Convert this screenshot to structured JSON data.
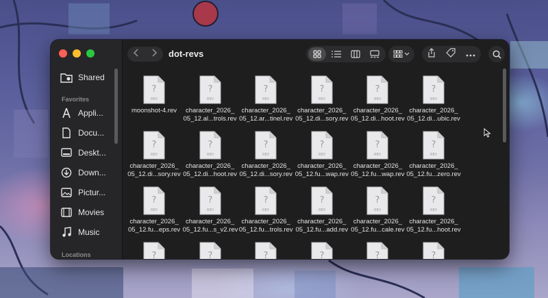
{
  "window": {
    "title": "dot-revs"
  },
  "sidebar": {
    "top_item": {
      "label": "Shared",
      "icon": "shared-folder-icon"
    },
    "section_favorites": "Favorites",
    "items": [
      {
        "label": "Appli...",
        "icon": "applications-icon"
      },
      {
        "label": "Docu...",
        "icon": "document-icon"
      },
      {
        "label": "Deskt...",
        "icon": "desktop-icon"
      },
      {
        "label": "Down...",
        "icon": "download-icon"
      },
      {
        "label": "Pictur...",
        "icon": "pictures-icon"
      },
      {
        "label": "Movies",
        "icon": "movies-icon"
      },
      {
        "label": "Music",
        "icon": "music-icon"
      }
    ],
    "section_locations": "Locations"
  },
  "file_icon_text": {
    "mark": "?",
    "ext": "REV"
  },
  "files": [
    {
      "line1": "moonshot-4.rev",
      "line2": ""
    },
    {
      "line1": "character_2026_",
      "line2": "05_12.al...trols.rev"
    },
    {
      "line1": "character_2026_",
      "line2": "05_12.ar...tinel.rev"
    },
    {
      "line1": "character_2026_",
      "line2": "05_12.di...sory.rev"
    },
    {
      "line1": "character_2026_",
      "line2": "05_12.di...hoot.rev"
    },
    {
      "line1": "character_2026_",
      "line2": "05_12.di...ubic.rev"
    },
    {
      "line1": "character_2026_",
      "line2": "05_12.di...sory.rev"
    },
    {
      "line1": "character_2026_",
      "line2": "05_12.di...hoot.rev"
    },
    {
      "line1": "character_2026_",
      "line2": "05_12.di...sory.rev"
    },
    {
      "line1": "character_2026_",
      "line2": "05_12.fu...wap.rev"
    },
    {
      "line1": "character_2026_",
      "line2": "05_12.fu...wap.rev"
    },
    {
      "line1": "character_2026_",
      "line2": "05_12.fu...zero.rev"
    },
    {
      "line1": "character_2026_",
      "line2": "05_12.fu...eps.rev"
    },
    {
      "line1": "character_2026_",
      "line2": "05_12.fu...s_v2.rev"
    },
    {
      "line1": "character_2026_",
      "line2": "05_12.fu...trols.rev"
    },
    {
      "line1": "character_2026_",
      "line2": "05_12.fu...add.rev"
    },
    {
      "line1": "character_2026_",
      "line2": "05_12.fu...cale.rev"
    },
    {
      "line1": "character_2026_",
      "line2": "05_12.fu...hoot.rev"
    },
    {
      "line1": "",
      "line2": ""
    },
    {
      "line1": "",
      "line2": ""
    },
    {
      "line1": "",
      "line2": ""
    },
    {
      "line1": "",
      "line2": ""
    },
    {
      "line1": "",
      "line2": ""
    },
    {
      "line1": "",
      "line2": ""
    }
  ],
  "colors": {
    "window_bg": "#1e1e1e",
    "sidebar_bg": "#262628",
    "text": "#e4e4e4"
  }
}
